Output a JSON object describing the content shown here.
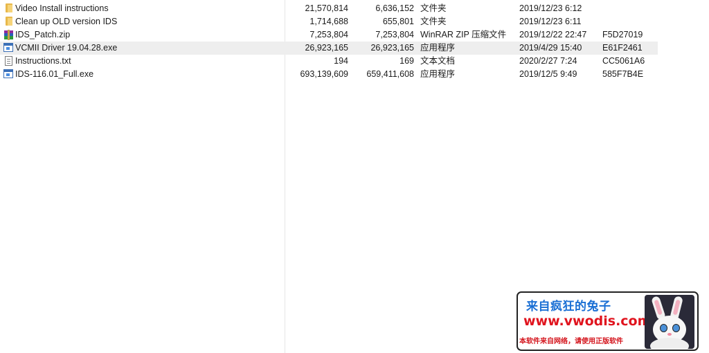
{
  "files": [
    {
      "icon": "folder-icon",
      "name": "Video Install instructions",
      "size": "21,570,814",
      "packed": "6,636,152",
      "type": "文件夹",
      "modified": "2019/12/23 6:12",
      "crc": "",
      "selected": false
    },
    {
      "icon": "folder-icon",
      "name": "Clean up OLD version IDS",
      "size": "1,714,688",
      "packed": "655,801",
      "type": "文件夹",
      "modified": "2019/12/23 6:11",
      "crc": "",
      "selected": false
    },
    {
      "icon": "zip-archive-icon",
      "name": "IDS_Patch.zip",
      "size": "7,253,804",
      "packed": "7,253,804",
      "type": "WinRAR ZIP 压缩文件",
      "modified": "2019/12/22 22:47",
      "crc": "F5D27019",
      "selected": false
    },
    {
      "icon": "exe-icon",
      "name": "VCMII Driver 19.04.28.exe",
      "size": "26,923,165",
      "packed": "26,923,165",
      "type": "应用程序",
      "modified": "2019/4/29 15:40",
      "crc": "E61F2461",
      "selected": true
    },
    {
      "icon": "text-file-icon",
      "name": "Instructions.txt",
      "size": "194",
      "packed": "169",
      "type": "文本文档",
      "modified": "2020/2/27 7:24",
      "crc": "CC5061A6",
      "selected": false
    },
    {
      "icon": "exe-icon",
      "name": "IDS-116.01_Full.exe",
      "size": "693,139,609",
      "packed": "659,411,608",
      "type": "应用程序",
      "modified": "2019/12/5 9:49",
      "crc": "585F7B4E",
      "selected": false
    }
  ],
  "banner": {
    "title": "来自疯狂的兔子",
    "url": "www.vwodis.com",
    "notice": "本软件来自网络，请使用正版软件",
    "colors": {
      "title": "#1a6fd4",
      "url": "#e0141e",
      "notice": "#d4141c"
    }
  }
}
